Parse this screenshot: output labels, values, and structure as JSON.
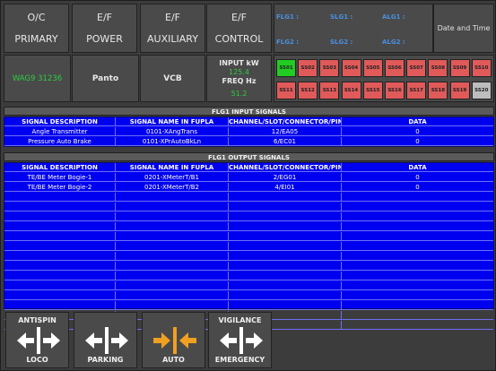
{
  "top_menu": [
    {
      "line1": "O/C",
      "line2": "PRIMARY"
    },
    {
      "line1": "E/F",
      "line2": "POWER"
    },
    {
      "line1": "E/F",
      "line2": "AUXILIARY"
    },
    {
      "line1": "E/F",
      "line2": "CONTROL"
    }
  ],
  "info": {
    "loco_id": "WAG9 31236",
    "panto": "Panto",
    "vcb": "VCB",
    "input_label": "INPUT kW",
    "input_value": "125.4",
    "freq_label": "FREQ Hz",
    "freq_value": "51.2"
  },
  "flg_status": {
    "flg1": "FLG1 :",
    "slg1": "SLG1 :",
    "alg1": "ALG1 :",
    "flg2": "FLG2 :",
    "slg2": "SLG2 :",
    "alg2": "ALG2 :"
  },
  "date_time_label": "Date and Time",
  "ss_row1": [
    "SS01",
    "SS02",
    "SS03",
    "SS04",
    "SS05",
    "SS06",
    "SS07",
    "SS08",
    "SS09",
    "SS10"
  ],
  "ss_row2": [
    "SS11",
    "SS12",
    "SS13",
    "SS14",
    "SS15",
    "SS16",
    "SS17",
    "SS18",
    "SS19",
    "SS20"
  ],
  "ss_colors": {
    "SS01": "#22cc22",
    "SS20": "#bdbdbd",
    "default": "#e05a5a"
  },
  "input_table": {
    "title": "FLG1 INPUT SIGNALS",
    "headers": [
      "SIGNAL DESCRIPTION",
      "SIGNAL NAME IN FUPLA",
      "CHANNEL/SLOT/CONNECTOR/PIN",
      "DATA"
    ],
    "rows": [
      [
        "Angle Transmitter",
        "0101-XAngTrans",
        "12/EA05",
        "0"
      ],
      [
        "Pressure Auto Brake",
        "0101-XPrAutoBkLn",
        "6/EC01",
        "0"
      ]
    ]
  },
  "output_table": {
    "title": "FLG1 OUTPUT SIGNALS",
    "headers": [
      "SIGNAL DESCRIPTION",
      "SIGNAL NAME IN FUPLA",
      "CHANNEL/SLOT/CONNECTOR/PIN",
      "DATA"
    ],
    "rows": [
      [
        "TE/BE Meter Bogie-1",
        "0201-XMeterT/B1",
        "2/EG01",
        "0"
      ],
      [
        "TE/BE Meter Bogie-2",
        "0201-XMeterT/B2",
        "4/EI01",
        "0"
      ]
    ],
    "empty_rows": 14
  },
  "bottom_buttons": [
    {
      "top": "ANTISPIN",
      "bottom": "LOCO",
      "color": "#ffffff"
    },
    {
      "top": "",
      "bottom": "PARKING",
      "color": "#ffffff"
    },
    {
      "top": "",
      "bottom": "AUTO",
      "color": "#f0a020"
    },
    {
      "top": "VIGILANCE",
      "bottom": "EMERGENCY",
      "color": "#ffffff"
    }
  ]
}
